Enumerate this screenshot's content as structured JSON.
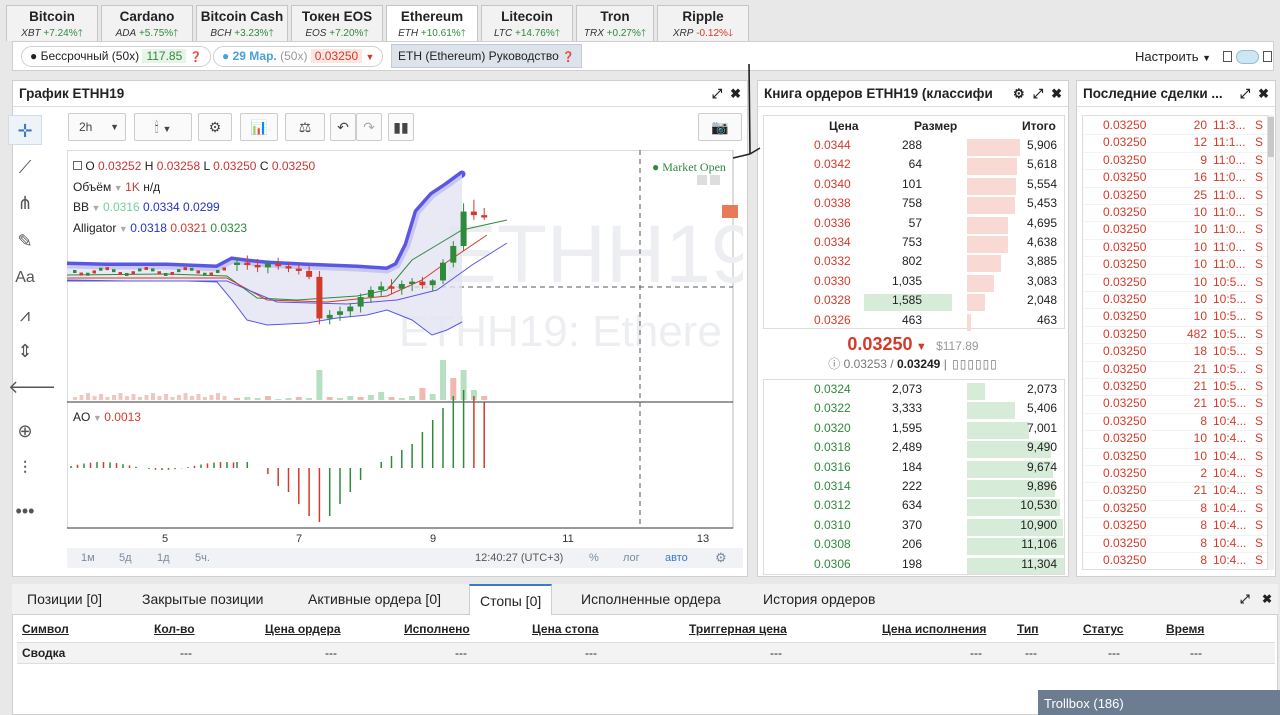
{
  "currency_tabs": [
    {
      "name": "Bitcoin",
      "ticker": "XBT",
      "change": "+7.24%",
      "dir": "up"
    },
    {
      "name": "Cardano",
      "ticker": "ADA",
      "change": "+5.75%",
      "dir": "up"
    },
    {
      "name": "Bitcoin Cash",
      "ticker": "BCH",
      "change": "+3.23%",
      "dir": "up"
    },
    {
      "name": "Токен EOS",
      "ticker": "EOS",
      "change": "+7.20%",
      "dir": "up"
    },
    {
      "name": "Ethereum",
      "ticker": "ETH",
      "change": "+10.61%",
      "dir": "up"
    },
    {
      "name": "Litecoin",
      "ticker": "LTC",
      "change": "+14.76%",
      "dir": "up"
    },
    {
      "name": "Tron",
      "ticker": "TRX",
      "change": "+0.27%",
      "dir": "up"
    },
    {
      "name": "Ripple",
      "ticker": "XRP",
      "change": "-0.12%",
      "dir": "down"
    }
  ],
  "contracts": {
    "perpetual_label": "Бессрочный (50x)",
    "perpetual_price": "117.85",
    "dated_label": "29 Мар.",
    "dated_leverage": "(50x)",
    "dated_price": "0.03250",
    "guide_label": "ETH (Ethereum) Руководство",
    "settings_label": "Настроить"
  },
  "chart_panel": {
    "title": "График ETHH19",
    "interval": "2h",
    "ohlc": {
      "o_label": "O",
      "o": "0.03252",
      "h_label": "H",
      "h": "0.03258",
      "l_label": "L",
      "l": "0.03250",
      "c_label": "C",
      "c": "0.03250"
    },
    "volume_label": "Объём",
    "volume_value": "1K",
    "volume_na": "н/д",
    "bb_label": "BB",
    "bb_values": [
      "0.0316",
      "0.0334",
      "0.0299"
    ],
    "alligator_label": "Alligator",
    "alligator_values": [
      "0.0318",
      "0.0321",
      "0.0323"
    ],
    "market_open": "Market Open",
    "watermark_symbol": "ETHH19",
    "watermark_desc": "ETHH19: Ethere",
    "ao_label": "AO",
    "ao_value": "0.0013",
    "x_ticks": [
      "5",
      "7",
      "9",
      "11",
      "13"
    ],
    "ranges": [
      "1м",
      "5д",
      "1д",
      "5ч."
    ],
    "clock": "12:40:27 (UTC+3)",
    "percent": "%",
    "log": "лог",
    "auto": "авто"
  },
  "chart_data": {
    "type": "candlestick",
    "symbol": "ETHH19",
    "x_ticks": [
      "5",
      "7",
      "9",
      "11",
      "13"
    ],
    "candles": [
      {
        "o": 0.0321,
        "h": 0.03216,
        "l": 0.03205,
        "c": 0.03212
      },
      {
        "o": 0.03212,
        "h": 0.03218,
        "l": 0.03206,
        "c": 0.0321
      },
      {
        "o": 0.0321,
        "h": 0.03215,
        "l": 0.03204,
        "c": 0.03208
      },
      {
        "o": 0.03208,
        "h": 0.03214,
        "l": 0.03203,
        "c": 0.03211
      },
      {
        "o": 0.03211,
        "h": 0.03216,
        "l": 0.03206,
        "c": 0.03209
      },
      {
        "o": 0.03209,
        "h": 0.03213,
        "l": 0.03204,
        "c": 0.03207
      },
      {
        "o": 0.03207,
        "h": 0.03212,
        "l": 0.03202,
        "c": 0.03205
      },
      {
        "o": 0.03205,
        "h": 0.03209,
        "l": 0.03198,
        "c": 0.032
      },
      {
        "o": 0.032,
        "h": 0.03205,
        "l": 0.0316,
        "c": 0.03165
      },
      {
        "o": 0.03165,
        "h": 0.03172,
        "l": 0.0316,
        "c": 0.03168
      },
      {
        "o": 0.03168,
        "h": 0.03175,
        "l": 0.03163,
        "c": 0.03171
      },
      {
        "o": 0.03171,
        "h": 0.03178,
        "l": 0.03166,
        "c": 0.03175
      },
      {
        "o": 0.03175,
        "h": 0.03186,
        "l": 0.0317,
        "c": 0.03183
      },
      {
        "o": 0.03183,
        "h": 0.03192,
        "l": 0.03178,
        "c": 0.03189
      },
      {
        "o": 0.03189,
        "h": 0.03196,
        "l": 0.03184,
        "c": 0.03192
      },
      {
        "o": 0.03192,
        "h": 0.03198,
        "l": 0.03186,
        "c": 0.0319
      },
      {
        "o": 0.0319,
        "h": 0.03197,
        "l": 0.03185,
        "c": 0.03194
      },
      {
        "o": 0.03194,
        "h": 0.03199,
        "l": 0.03188,
        "c": 0.03196
      },
      {
        "o": 0.03196,
        "h": 0.032,
        "l": 0.0319,
        "c": 0.03193
      },
      {
        "o": 0.03193,
        "h": 0.03198,
        "l": 0.03188,
        "c": 0.03197
      },
      {
        "o": 0.03197,
        "h": 0.03215,
        "l": 0.03194,
        "c": 0.03212
      },
      {
        "o": 0.03212,
        "h": 0.0323,
        "l": 0.03208,
        "c": 0.03226
      },
      {
        "o": 0.03226,
        "h": 0.03262,
        "l": 0.03222,
        "c": 0.03255
      },
      {
        "o": 0.03255,
        "h": 0.03265,
        "l": 0.03248,
        "c": 0.03252
      },
      {
        "o": 0.03252,
        "h": 0.03258,
        "l": 0.03248,
        "c": 0.0325
      }
    ],
    "ao_values": [
      0.0001,
      0.0001,
      0.0,
      -0.0001,
      -0.0003,
      -0.0004,
      -0.0006,
      -0.0008,
      -0.0009,
      -0.0008,
      -0.0006,
      -0.0004,
      -0.0002,
      0.0,
      0.0001,
      0.0002,
      0.0003,
      0.0004,
      0.0006,
      0.0008,
      0.001,
      0.0012,
      0.0013,
      0.0012,
      0.0011
    ],
    "current_price": "0.03250"
  },
  "orderbook": {
    "title": "Книга ордеров ETHH19 (классифи",
    "columns": [
      "Цена",
      "Размер",
      "Итого"
    ],
    "asks": [
      {
        "price": "0.0344",
        "size": "288",
        "total": "5,906",
        "depth": 0.53
      },
      {
        "price": "0.0342",
        "size": "64",
        "total": "5,618",
        "depth": 0.5
      },
      {
        "price": "0.0340",
        "size": "101",
        "total": "5,554",
        "depth": 0.49
      },
      {
        "price": "0.0338",
        "size": "758",
        "total": "5,453",
        "depth": 0.48
      },
      {
        "price": "0.0336",
        "size": "57",
        "total": "4,695",
        "depth": 0.41
      },
      {
        "price": "0.0334",
        "size": "753",
        "total": "4,638",
        "depth": 0.41
      },
      {
        "price": "0.0332",
        "size": "802",
        "total": "3,885",
        "depth": 0.34
      },
      {
        "price": "0.0330",
        "size": "1,035",
        "total": "3,083",
        "depth": 0.27
      },
      {
        "price": "0.0328",
        "size": "1,585",
        "total": "2,048",
        "depth": 0.18,
        "ownsize": 0.88
      },
      {
        "price": "0.0326",
        "size": "463",
        "total": "463",
        "depth": 0.04
      }
    ],
    "last_price": "0.03250",
    "last_usd": "$117.89",
    "index_price": "0.03253",
    "mark_price": "0.03249",
    "bids": [
      {
        "price": "0.0324",
        "size": "2,073",
        "total": "2,073",
        "depth": 0.18
      },
      {
        "price": "0.0322",
        "size": "3,333",
        "total": "5,406",
        "depth": 0.48
      },
      {
        "price": "0.0320",
        "size": "1,595",
        "total": "7,001",
        "depth": 0.62
      },
      {
        "price": "0.0318",
        "size": "2,489",
        "total": "9,490",
        "depth": 0.84
      },
      {
        "price": "0.0316",
        "size": "184",
        "total": "9,674",
        "depth": 0.86
      },
      {
        "price": "0.0314",
        "size": "222",
        "total": "9,896",
        "depth": 0.88
      },
      {
        "price": "0.0312",
        "size": "634",
        "total": "10,530",
        "depth": 0.93
      },
      {
        "price": "0.0310",
        "size": "370",
        "total": "10,900",
        "depth": 0.96
      },
      {
        "price": "0.0308",
        "size": "206",
        "total": "11,106",
        "depth": 0.98
      },
      {
        "price": "0.0306",
        "size": "198",
        "total": "11,304",
        "depth": 1.0
      }
    ]
  },
  "trades": {
    "title": "Последние сделки ...",
    "rows": [
      {
        "price": "0.03250",
        "qty": "20",
        "time": "11:3...",
        "side": "S"
      },
      {
        "price": "0.03250",
        "qty": "12",
        "time": "11:1...",
        "side": "S"
      },
      {
        "price": "0.03250",
        "qty": "9",
        "time": "11:0...",
        "side": "S"
      },
      {
        "price": "0.03250",
        "qty": "16",
        "time": "11:0...",
        "side": "S"
      },
      {
        "price": "0.03250",
        "qty": "25",
        "time": "11:0...",
        "side": "S"
      },
      {
        "price": "0.03250",
        "qty": "10",
        "time": "11:0...",
        "side": "S"
      },
      {
        "price": "0.03250",
        "qty": "10",
        "time": "11:0...",
        "side": "S"
      },
      {
        "price": "0.03250",
        "qty": "10",
        "time": "11:0...",
        "side": "S"
      },
      {
        "price": "0.03250",
        "qty": "10",
        "time": "11:0...",
        "side": "S"
      },
      {
        "price": "0.03250",
        "qty": "10",
        "time": "10:5...",
        "side": "S"
      },
      {
        "price": "0.03250",
        "qty": "10",
        "time": "10:5...",
        "side": "S"
      },
      {
        "price": "0.03250",
        "qty": "10",
        "time": "10:5...",
        "side": "S"
      },
      {
        "price": "0.03250",
        "qty": "482",
        "time": "10:5...",
        "side": "S"
      },
      {
        "price": "0.03250",
        "qty": "18",
        "time": "10:5...",
        "side": "S"
      },
      {
        "price": "0.03250",
        "qty": "21",
        "time": "10:5...",
        "side": "S"
      },
      {
        "price": "0.03250",
        "qty": "21",
        "time": "10:5...",
        "side": "S"
      },
      {
        "price": "0.03250",
        "qty": "21",
        "time": "10:5...",
        "side": "S"
      },
      {
        "price": "0.03250",
        "qty": "8",
        "time": "10:4...",
        "side": "S"
      },
      {
        "price": "0.03250",
        "qty": "10",
        "time": "10:4...",
        "side": "S"
      },
      {
        "price": "0.03250",
        "qty": "10",
        "time": "10:4...",
        "side": "S"
      },
      {
        "price": "0.03250",
        "qty": "2",
        "time": "10:4...",
        "side": "S"
      },
      {
        "price": "0.03250",
        "qty": "21",
        "time": "10:4...",
        "side": "S"
      },
      {
        "price": "0.03250",
        "qty": "8",
        "time": "10:4...",
        "side": "S"
      },
      {
        "price": "0.03250",
        "qty": "8",
        "time": "10:4...",
        "side": "S"
      },
      {
        "price": "0.03250",
        "qty": "8",
        "time": "10:4...",
        "side": "S"
      },
      {
        "price": "0.03250",
        "qty": "8",
        "time": "10:4...",
        "side": "S"
      }
    ]
  },
  "bottom": {
    "tabs": [
      "Позиции [0]",
      "Закрытые позиции",
      "Активные ордера [0]",
      "Стопы [0]",
      "Исполненные ордера",
      "История ордеров"
    ],
    "active_tab": 3,
    "columns": [
      "Символ",
      "Кол-во",
      "Цена ордера",
      "Исполнено",
      "Цена стопа",
      "Триггерная цена",
      "Цена исполнения",
      "Тип",
      "Статус",
      "Время"
    ],
    "summary_label": "Сводка",
    "summary_values": [
      "---",
      "---",
      "---",
      "---",
      "---",
      "---",
      "---",
      "---",
      "---"
    ]
  },
  "trollbox": {
    "label": "Trollbox (186)"
  },
  "colors": {
    "up": "#2e8b3a",
    "down": "#d43a2a",
    "accent": "#3a7bc8",
    "ask_bar": "#f9d9d3",
    "bid_bar": "#d6ecd9",
    "bb_band": "#5a57e6"
  }
}
